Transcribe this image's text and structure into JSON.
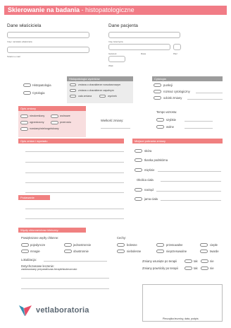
{
  "header": {
    "title_bold": "Skierowanie na badania",
    "title_sep": " - ",
    "title_rest": "histopatologiczne"
  },
  "owner": {
    "title": "Dane właściciela",
    "name_label": "Imię i nazwisko właściciela",
    "phone_label": "Telefon e-mail"
  },
  "patient": {
    "title": "Dane pacjenta",
    "name_label": "Imię zwierzęcia",
    "species_label": "Gatunek",
    "breed_label": "Rasa",
    "sex_label": "Płeć",
    "age_label": "Wiek"
  },
  "exam_type": {
    "items": [
      "Histopatologia",
      "Cytologia"
    ]
  },
  "histo": {
    "header": "Histopatologia wycinków",
    "items": [
      "zmiana o charakterze nowotworowym",
      "zmiana o charakterze zapalnym",
      "cała zmiana",
      "wycinek"
    ]
  },
  "cyto": {
    "header": "Cytologia",
    "items": [
      "punkcji",
      "rozmaz cytologiczny",
      "odcisk zmiany"
    ]
  },
  "change_desc": {
    "header": "Opis zmiany",
    "items": [
      "nieokreślony",
      "wolnowe",
      "ograniczony",
      "przerostu",
      "rozsiany/wieloogniskowy"
    ],
    "size_label": "Wielkość zmiany:",
    "growth_label": "Tempo wzrostu:",
    "growth_items": [
      "szybkie",
      "wolne"
    ]
  },
  "history": {
    "header": "Opis zmian i wywiadu"
  },
  "location": {
    "header": "Miejsce pobrania zmiany",
    "items": [
      "skóra",
      "tkanka podskórna",
      "mięśnie"
    ],
    "body_region_label": "Okolica ciała",
    "extra_items": [
      "narząd",
      "jama ciała"
    ]
  },
  "treatment": {
    "header": "Podawanie"
  },
  "lymph": {
    "header": "Węzły chłonne/obraz kliniczny:",
    "enlarged_label": "Powiększone węzły chłonne:",
    "enlarged_items": [
      "pojedyncze",
      "jednostronnie",
      "mnogie",
      "obustronnie"
    ],
    "features_label": "Cechy:",
    "features_items": [
      "bolesne",
      "przesuwalne",
      "ciepłe",
      "niebolesne",
      "nieprzesuwalne",
      "twarde"
    ],
    "localization_label": "Lokalizacja:",
    "previous_label": "Dotychczasowe leczenie:",
    "previous_sub": "zastosowany preparat/czas terapii/skuteczność",
    "ulcer_label": "Zmiany usunięte po terapii",
    "recurrence_label": "Zmiany powróciły po terapii",
    "yes": "tak",
    "no": "nie"
  },
  "footer": {
    "brand": "vetlaboratoria",
    "signature_caption": "Pieczątka lecznicy, data, podpis",
    "brand_colors": [
      "#3aa6c9",
      "#e84c67"
    ]
  }
}
